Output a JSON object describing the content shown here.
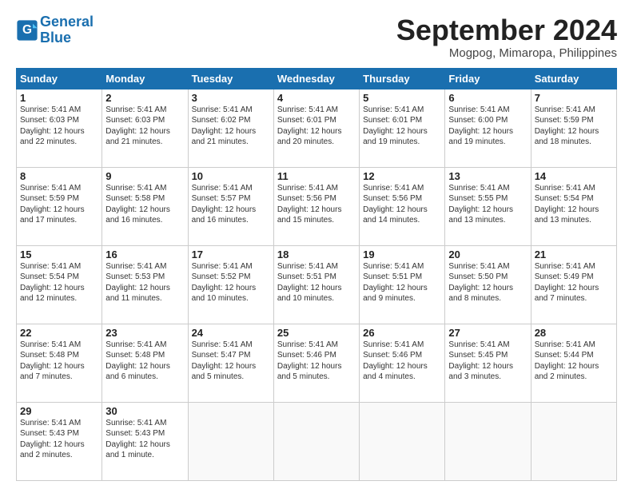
{
  "header": {
    "logo_line1": "General",
    "logo_line2": "Blue",
    "month": "September 2024",
    "location": "Mogpog, Mimaropa, Philippines"
  },
  "weekdays": [
    "Sunday",
    "Monday",
    "Tuesday",
    "Wednesday",
    "Thursday",
    "Friday",
    "Saturday"
  ],
  "weeks": [
    [
      {
        "day": "1",
        "lines": [
          "Sunrise: 5:41 AM",
          "Sunset: 6:03 PM",
          "Daylight: 12 hours",
          "and 22 minutes."
        ]
      },
      {
        "day": "2",
        "lines": [
          "Sunrise: 5:41 AM",
          "Sunset: 6:03 PM",
          "Daylight: 12 hours",
          "and 21 minutes."
        ]
      },
      {
        "day": "3",
        "lines": [
          "Sunrise: 5:41 AM",
          "Sunset: 6:02 PM",
          "Daylight: 12 hours",
          "and 21 minutes."
        ]
      },
      {
        "day": "4",
        "lines": [
          "Sunrise: 5:41 AM",
          "Sunset: 6:01 PM",
          "Daylight: 12 hours",
          "and 20 minutes."
        ]
      },
      {
        "day": "5",
        "lines": [
          "Sunrise: 5:41 AM",
          "Sunset: 6:01 PM",
          "Daylight: 12 hours",
          "and 19 minutes."
        ]
      },
      {
        "day": "6",
        "lines": [
          "Sunrise: 5:41 AM",
          "Sunset: 6:00 PM",
          "Daylight: 12 hours",
          "and 19 minutes."
        ]
      },
      {
        "day": "7",
        "lines": [
          "Sunrise: 5:41 AM",
          "Sunset: 5:59 PM",
          "Daylight: 12 hours",
          "and 18 minutes."
        ]
      }
    ],
    [
      {
        "day": "8",
        "lines": [
          "Sunrise: 5:41 AM",
          "Sunset: 5:59 PM",
          "Daylight: 12 hours",
          "and 17 minutes."
        ]
      },
      {
        "day": "9",
        "lines": [
          "Sunrise: 5:41 AM",
          "Sunset: 5:58 PM",
          "Daylight: 12 hours",
          "and 16 minutes."
        ]
      },
      {
        "day": "10",
        "lines": [
          "Sunrise: 5:41 AM",
          "Sunset: 5:57 PM",
          "Daylight: 12 hours",
          "and 16 minutes."
        ]
      },
      {
        "day": "11",
        "lines": [
          "Sunrise: 5:41 AM",
          "Sunset: 5:56 PM",
          "Daylight: 12 hours",
          "and 15 minutes."
        ]
      },
      {
        "day": "12",
        "lines": [
          "Sunrise: 5:41 AM",
          "Sunset: 5:56 PM",
          "Daylight: 12 hours",
          "and 14 minutes."
        ]
      },
      {
        "day": "13",
        "lines": [
          "Sunrise: 5:41 AM",
          "Sunset: 5:55 PM",
          "Daylight: 12 hours",
          "and 13 minutes."
        ]
      },
      {
        "day": "14",
        "lines": [
          "Sunrise: 5:41 AM",
          "Sunset: 5:54 PM",
          "Daylight: 12 hours",
          "and 13 minutes."
        ]
      }
    ],
    [
      {
        "day": "15",
        "lines": [
          "Sunrise: 5:41 AM",
          "Sunset: 5:54 PM",
          "Daylight: 12 hours",
          "and 12 minutes."
        ]
      },
      {
        "day": "16",
        "lines": [
          "Sunrise: 5:41 AM",
          "Sunset: 5:53 PM",
          "Daylight: 12 hours",
          "and 11 minutes."
        ]
      },
      {
        "day": "17",
        "lines": [
          "Sunrise: 5:41 AM",
          "Sunset: 5:52 PM",
          "Daylight: 12 hours",
          "and 10 minutes."
        ]
      },
      {
        "day": "18",
        "lines": [
          "Sunrise: 5:41 AM",
          "Sunset: 5:51 PM",
          "Daylight: 12 hours",
          "and 10 minutes."
        ]
      },
      {
        "day": "19",
        "lines": [
          "Sunrise: 5:41 AM",
          "Sunset: 5:51 PM",
          "Daylight: 12 hours",
          "and 9 minutes."
        ]
      },
      {
        "day": "20",
        "lines": [
          "Sunrise: 5:41 AM",
          "Sunset: 5:50 PM",
          "Daylight: 12 hours",
          "and 8 minutes."
        ]
      },
      {
        "day": "21",
        "lines": [
          "Sunrise: 5:41 AM",
          "Sunset: 5:49 PM",
          "Daylight: 12 hours",
          "and 7 minutes."
        ]
      }
    ],
    [
      {
        "day": "22",
        "lines": [
          "Sunrise: 5:41 AM",
          "Sunset: 5:48 PM",
          "Daylight: 12 hours",
          "and 7 minutes."
        ]
      },
      {
        "day": "23",
        "lines": [
          "Sunrise: 5:41 AM",
          "Sunset: 5:48 PM",
          "Daylight: 12 hours",
          "and 6 minutes."
        ]
      },
      {
        "day": "24",
        "lines": [
          "Sunrise: 5:41 AM",
          "Sunset: 5:47 PM",
          "Daylight: 12 hours",
          "and 5 minutes."
        ]
      },
      {
        "day": "25",
        "lines": [
          "Sunrise: 5:41 AM",
          "Sunset: 5:46 PM",
          "Daylight: 12 hours",
          "and 5 minutes."
        ]
      },
      {
        "day": "26",
        "lines": [
          "Sunrise: 5:41 AM",
          "Sunset: 5:46 PM",
          "Daylight: 12 hours",
          "and 4 minutes."
        ]
      },
      {
        "day": "27",
        "lines": [
          "Sunrise: 5:41 AM",
          "Sunset: 5:45 PM",
          "Daylight: 12 hours",
          "and 3 minutes."
        ]
      },
      {
        "day": "28",
        "lines": [
          "Sunrise: 5:41 AM",
          "Sunset: 5:44 PM",
          "Daylight: 12 hours",
          "and 2 minutes."
        ]
      }
    ],
    [
      {
        "day": "29",
        "lines": [
          "Sunrise: 5:41 AM",
          "Sunset: 5:43 PM",
          "Daylight: 12 hours",
          "and 2 minutes."
        ]
      },
      {
        "day": "30",
        "lines": [
          "Sunrise: 5:41 AM",
          "Sunset: 5:43 PM",
          "Daylight: 12 hours",
          "and 1 minute."
        ]
      },
      null,
      null,
      null,
      null,
      null
    ]
  ]
}
